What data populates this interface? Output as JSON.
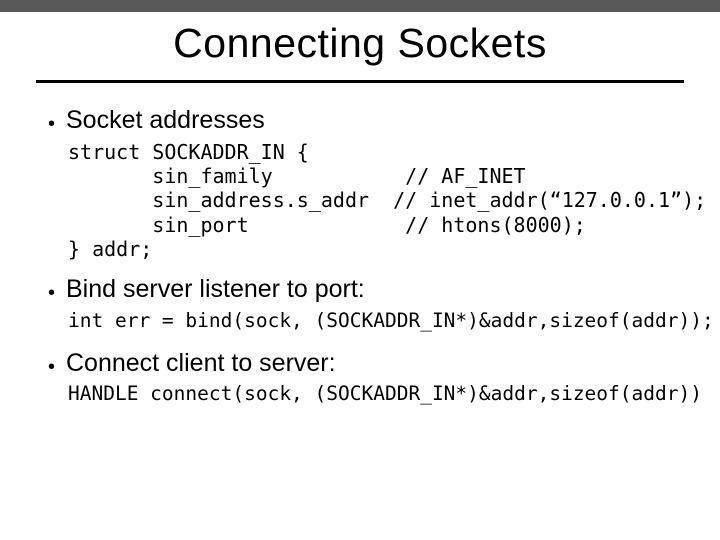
{
  "title": "Connecting Sockets",
  "bullets": {
    "b1": "Socket addresses",
    "b2": "Bind server listener to port:",
    "b3": "Connect client to server:"
  },
  "code": {
    "struct_open": "struct SOCKADDR_IN {",
    "fam_field": "       sin_family",
    "fam_comment": "  // AF_INET",
    "addr_field": "       sin_address.s_addr",
    "addr_comment": "  // inet_addr(“127.0.0.1”);",
    "port_field": "       sin_port",
    "port_comment": "  // htons(8000);",
    "struct_close": "} addr;",
    "bind": "int err = bind(sock, (SOCKADDR_IN*)&addr,sizeof(addr));",
    "connect": "HANDLE connect(sock, (SOCKADDR_IN*)&addr,sizeof(addr))"
  }
}
